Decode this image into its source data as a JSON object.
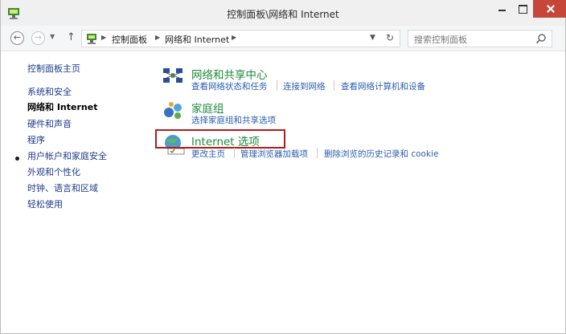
{
  "window": {
    "title": "控制面板\\网络和 Internet"
  },
  "address_bar": {
    "crumbs": [
      "控制面板",
      "网络和 Internet"
    ]
  },
  "search": {
    "placeholder": "搜索控制面板"
  },
  "sidebar": {
    "items": [
      {
        "label": "控制面板主页"
      },
      {
        "label": "系统和安全"
      },
      {
        "label": "网络和 Internet",
        "active": true
      },
      {
        "label": "硬件和声音"
      },
      {
        "label": "程序"
      },
      {
        "label": "用户帐户和家庭安全"
      },
      {
        "label": "外观和个性化"
      },
      {
        "label": "时钟、语言和区域"
      },
      {
        "label": "轻松使用"
      }
    ]
  },
  "categories": [
    {
      "title": "网络和共享中心",
      "icon": "network-sharing-icon",
      "links": [
        "查看网络状态和任务",
        "连接到网络",
        "查看网络计算机和设备"
      ]
    },
    {
      "title": "家庭组",
      "icon": "homegroup-icon",
      "links": [
        "选择家庭组和共享选项"
      ]
    },
    {
      "title": "Internet 选项",
      "icon": "internet-options-icon",
      "links": [
        "更改主页",
        "管理浏览器加载项",
        "删除浏览的历史记录和 cookie"
      ]
    }
  ],
  "colors": {
    "category_title": "#1e8a3a",
    "link": "#2a5db0",
    "highlight_border": "#b21b1b",
    "close_button": "#c7463a"
  }
}
